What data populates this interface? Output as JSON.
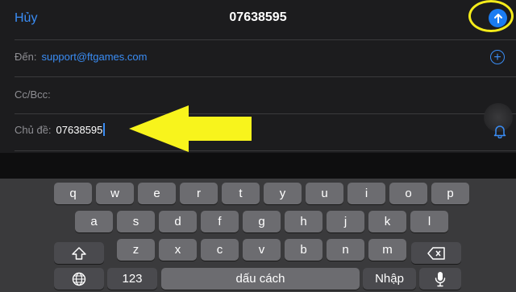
{
  "nav": {
    "cancel_label": "Hủy",
    "title": "07638595"
  },
  "fields": {
    "to_label": "Đến:",
    "to_value": "support@ftgames.com",
    "cc_label": "Cc/Bcc:",
    "subject_label": "Chủ đề:",
    "subject_value": "07638595"
  },
  "keyboard": {
    "row1": [
      "q",
      "w",
      "e",
      "r",
      "t",
      "y",
      "u",
      "i",
      "o",
      "p"
    ],
    "row2": [
      "a",
      "s",
      "d",
      "f",
      "g",
      "h",
      "j",
      "k",
      "l"
    ],
    "row3": [
      "z",
      "x",
      "c",
      "v",
      "b",
      "n",
      "m"
    ],
    "numbers_label": "123",
    "space_label": "dấu cách",
    "return_label": "Nhập"
  },
  "colors": {
    "accent": "#3a8df5",
    "highlight": "#f5ec1a",
    "send": "#1a7cf2"
  },
  "icons": [
    "send-arrow-icon",
    "add-contact-icon",
    "bell-icon",
    "shift-icon",
    "delete-icon",
    "globe-icon",
    "microphone-icon"
  ]
}
